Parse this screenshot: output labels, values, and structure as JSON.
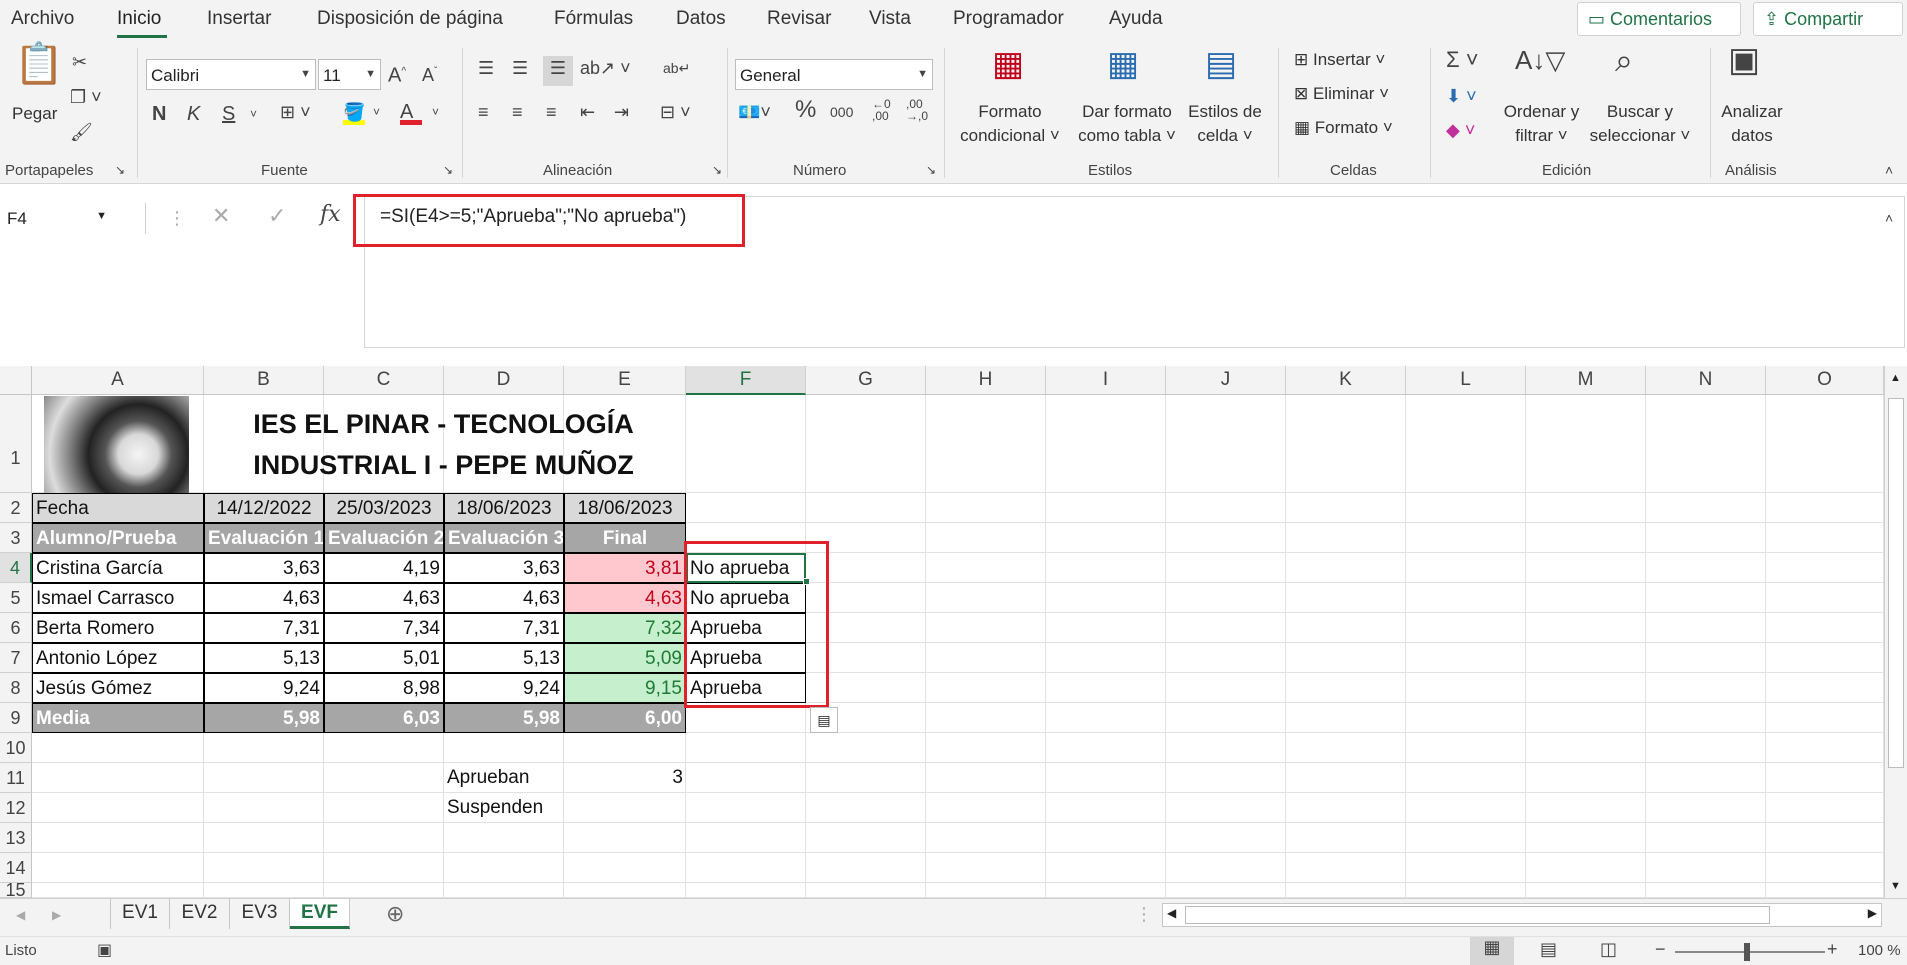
{
  "menu": {
    "tabs": [
      "Archivo",
      "Inicio",
      "Insertar",
      "Disposición de página",
      "Fórmulas",
      "Datos",
      "Revisar",
      "Vista",
      "Programador",
      "Ayuda"
    ],
    "comments": "Comentarios",
    "share": "Compartir"
  },
  "ribbon": {
    "paste": "Pegar",
    "group_clipboard": "Portapapeles",
    "font_name": "Calibri",
    "font_size": "11",
    "bold": "N",
    "italic": "K",
    "underline": "S",
    "group_font": "Fuente",
    "group_align": "Alineación",
    "number_format": "General",
    "group_number": "Número",
    "percent": "%",
    "thousands": "000",
    "cond_format_1": "Formato",
    "cond_format_2": "condicional",
    "table_format_1": "Dar formato",
    "table_format_2": "como tabla",
    "cell_styles_1": "Estilos de",
    "cell_styles_2": "celda",
    "group_styles": "Estilos",
    "insert": "Insertar",
    "delete": "Eliminar",
    "format": "Formato",
    "group_cells": "Celdas",
    "sort_1": "Ordenar y",
    "sort_2": "filtrar",
    "find_1": "Buscar y",
    "find_2": "seleccionar",
    "group_edit": "Edición",
    "analyze_1": "Analizar",
    "analyze_2": "datos",
    "group_analysis": "Análisis"
  },
  "formula_bar": {
    "cell_ref": "F4",
    "fx": "fx",
    "formula": "=SI(E4>=5;\"Aprueba\";\"No aprueba\")"
  },
  "columns": [
    "A",
    "B",
    "C",
    "D",
    "E",
    "F",
    "G",
    "H",
    "I",
    "J",
    "K",
    "L",
    "M",
    "N",
    "O"
  ],
  "rows": [
    "1",
    "2",
    "3",
    "4",
    "5",
    "6",
    "7",
    "8",
    "9",
    "10",
    "11",
    "12",
    "13",
    "14",
    "15"
  ],
  "sheet": {
    "title_line1": "IES EL PINAR - TECNOLOGÍA",
    "title_line2": "INDUSTRIAL I - PEPE MUÑOZ",
    "date_label": "Fecha",
    "dates": [
      "14/12/2022",
      "25/03/2023",
      "18/06/2023",
      "18/06/2023"
    ],
    "header": [
      "Alumno/Prueba",
      "Evaluación 1",
      "Evaluación 2",
      "Evaluación 3",
      "Final"
    ],
    "students": [
      {
        "name": "Cristina García",
        "e1": "3,63",
        "e2": "4,19",
        "e3": "3,63",
        "final": "3,81",
        "result": "No aprueba",
        "pass": false
      },
      {
        "name": "Ismael Carrasco",
        "e1": "4,63",
        "e2": "4,63",
        "e3": "4,63",
        "final": "4,63",
        "result": "No aprueba",
        "pass": false
      },
      {
        "name": "Berta Romero",
        "e1": "7,31",
        "e2": "7,34",
        "e3": "7,31",
        "final": "7,32",
        "result": "Aprueba",
        "pass": true
      },
      {
        "name": "Antonio López",
        "e1": "5,13",
        "e2": "5,01",
        "e3": "5,13",
        "final": "5,09",
        "result": "Aprueba",
        "pass": true
      },
      {
        "name": "Jesús Gómez",
        "e1": "9,24",
        "e2": "8,98",
        "e3": "9,24",
        "final": "9,15",
        "result": "Aprueba",
        "pass": true
      }
    ],
    "mean_label": "Media",
    "means": [
      "5,98",
      "6,03",
      "5,98",
      "6,00"
    ],
    "approve_label": "Aprueban",
    "approve_count": "3",
    "fail_label": "Suspenden"
  },
  "sheet_tabs": [
    "EV1",
    "EV2",
    "EV3",
    "EVF"
  ],
  "active_tab": "EVF",
  "status": {
    "ready": "Listo",
    "zoom": "100 %"
  },
  "colors": {
    "accent": "#217346",
    "header_gray": "#a6a6a6",
    "fail_bg": "#ffc7ce",
    "fail_text": "#c0001a",
    "pass_bg": "#c6efce",
    "pass_text": "#1e7b34",
    "highlight": "#e0202a"
  }
}
